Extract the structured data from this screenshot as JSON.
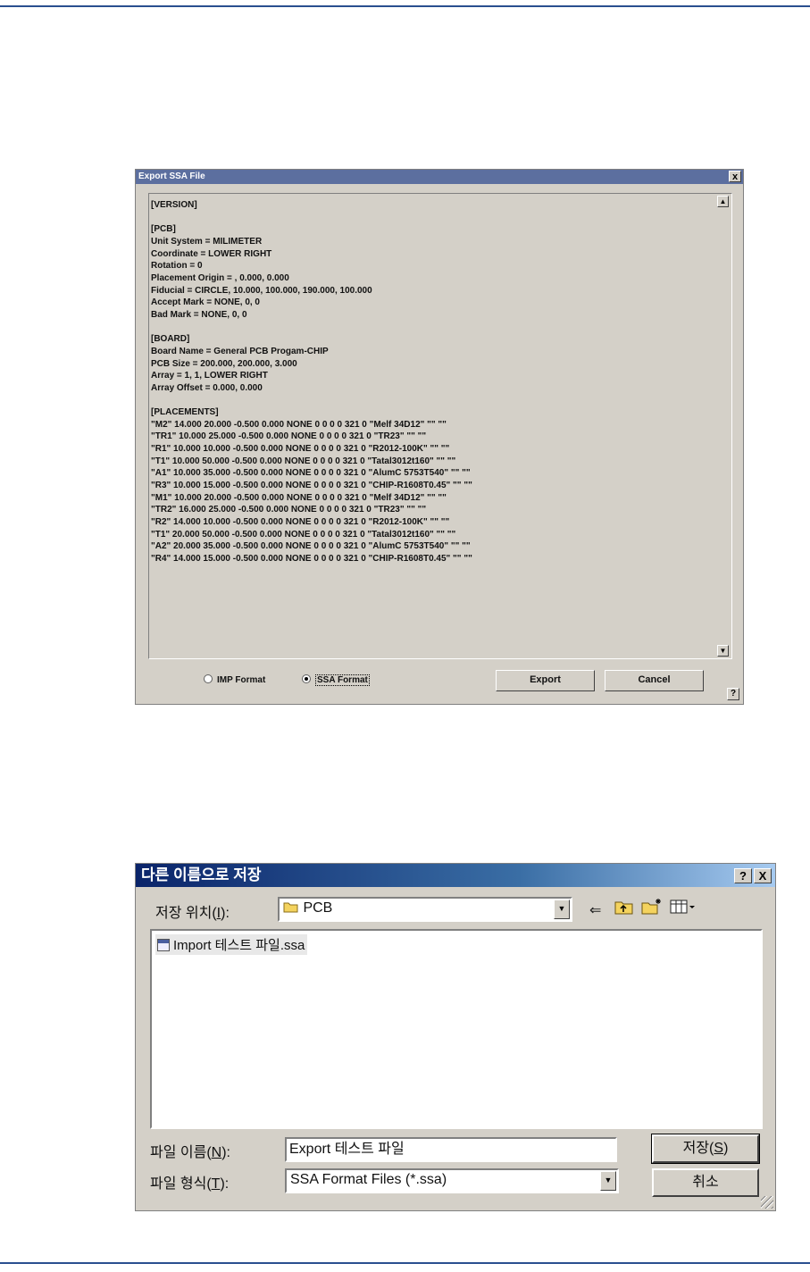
{
  "export_dialog": {
    "title": "Export SSA File",
    "close_label": "x",
    "content": "[VERSION]\n\n[PCB]\nUnit System = MILIMETER\nCoordinate = LOWER RIGHT\nRotation = 0\nPlacement Origin = , 0.000, 0.000\nFiducial = CIRCLE, 10.000, 100.000, 190.000, 100.000\nAccept Mark = NONE, 0, 0\nBad Mark = NONE, 0, 0\n\n[BOARD]\nBoard Name = General PCB Progam-CHIP\nPCB Size = 200.000, 200.000, 3.000\nArray = 1, 1, LOWER RIGHT\nArray Offset = 0.000, 0.000\n\n[PLACEMENTS]\n\"M2\" 14.000 20.000 -0.500 0.000 NONE 0 0 0 0 321 0 \"Melf 34D12\" \"\" \"\"\n\"TR1\" 10.000 25.000 -0.500 0.000 NONE 0 0 0 0 321 0 \"TR23\" \"\" \"\"\n\"R1\" 10.000 10.000 -0.500 0.000 NONE 0 0 0 0 321 0 \"R2012-100K\" \"\" \"\"\n\"T1\" 10.000 50.000 -0.500 0.000 NONE 0 0 0 0 321 0 \"Tatal3012t160\" \"\" \"\"\n\"A1\" 10.000 35.000 -0.500 0.000 NONE 0 0 0 0 321 0 \"AlumC 5753T540\" \"\" \"\"\n\"R3\" 10.000 15.000 -0.500 0.000 NONE 0 0 0 0 321 0 \"CHIP-R1608T0.45\" \"\" \"\"\n\"M1\" 10.000 20.000 -0.500 0.000 NONE 0 0 0 0 321 0 \"Melf 34D12\" \"\" \"\"\n\"TR2\" 16.000 25.000 -0.500 0.000 NONE 0 0 0 0 321 0 \"TR23\" \"\" \"\"\n\"R2\" 14.000 10.000 -0.500 0.000 NONE 0 0 0 0 321 0 \"R2012-100K\" \"\" \"\"\n\"T1\" 20.000 50.000 -0.500 0.000 NONE 0 0 0 0 321 0 \"Tatal3012t160\" \"\" \"\"\n\"A2\" 20.000 35.000 -0.500 0.000 NONE 0 0 0 0 321 0 \"AlumC 5753T540\" \"\" \"\"\n\"R4\" 14.000 15.000 -0.500 0.000 NONE 0 0 0 0 321 0 \"CHIP-R1608T0.45\" \"\" \"\"",
    "format_options": [
      {
        "label": "IMP Format",
        "selected": false
      },
      {
        "label": "SSA Format",
        "selected": true
      }
    ],
    "export_label": "Export",
    "cancel_label": "Cancel",
    "help_label": "?"
  },
  "save_dialog": {
    "title": "다른 이름으로 저장",
    "help_label": "?",
    "close_label": "X",
    "location_label_pre": "저장 위치(",
    "location_label_acc": "I",
    "location_label_post": "):",
    "location_value": "PCB",
    "files": [
      "Import 테스트 파일.ssa"
    ],
    "filename_label_pre": "파일 이름(",
    "filename_label_acc": "N",
    "filename_label_post": "):",
    "filename_value": "Export 테스트 파일",
    "filetype_label_pre": "파일 형식(",
    "filetype_label_acc": "T",
    "filetype_label_post": "):",
    "filetype_value": "SSA Format Files (*.ssa)",
    "save_label_pre": "저장(",
    "save_label_acc": "S",
    "save_label_post": ")",
    "cancel_label": "취소"
  },
  "colors": {
    "rule": "#2a4f8f",
    "dialog_face": "#d4d0c8",
    "title_active": "#0a246a"
  }
}
